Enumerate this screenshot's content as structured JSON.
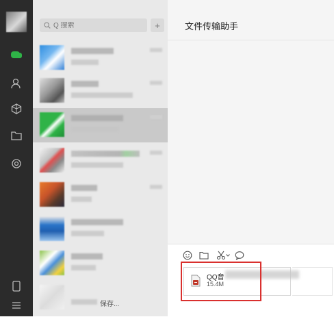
{
  "colors": {
    "rail_bg": "#2b2b2b",
    "list_bg": "#e9e9e9",
    "selected_bg": "#c9c9c9",
    "chat_bg": "#f5f5f5",
    "accent_green": "#2fb347",
    "highlight_red": "#d9302e"
  },
  "rail": {
    "icons": [
      "chat-icon",
      "contacts-icon",
      "favorites-icon",
      "files-icon",
      "moments-icon",
      "phone-icon",
      "menu-icon"
    ]
  },
  "search": {
    "placeholder": "Q 搜索",
    "add_label": "+"
  },
  "conversations": [
    {
      "label": ""
    },
    {
      "label": ""
    },
    {
      "label": ""
    },
    {
      "label": ""
    },
    {
      "label": ""
    },
    {
      "label": ""
    },
    {
      "label": ""
    },
    {
      "label": "保存..."
    }
  ],
  "chat": {
    "title": "文件传输助手",
    "toolbar": [
      "emoji-icon",
      "folder-icon",
      "scissors-icon",
      "chat-bubble-icon"
    ],
    "file": {
      "name": "QQ音",
      "size": "15.4M"
    }
  }
}
